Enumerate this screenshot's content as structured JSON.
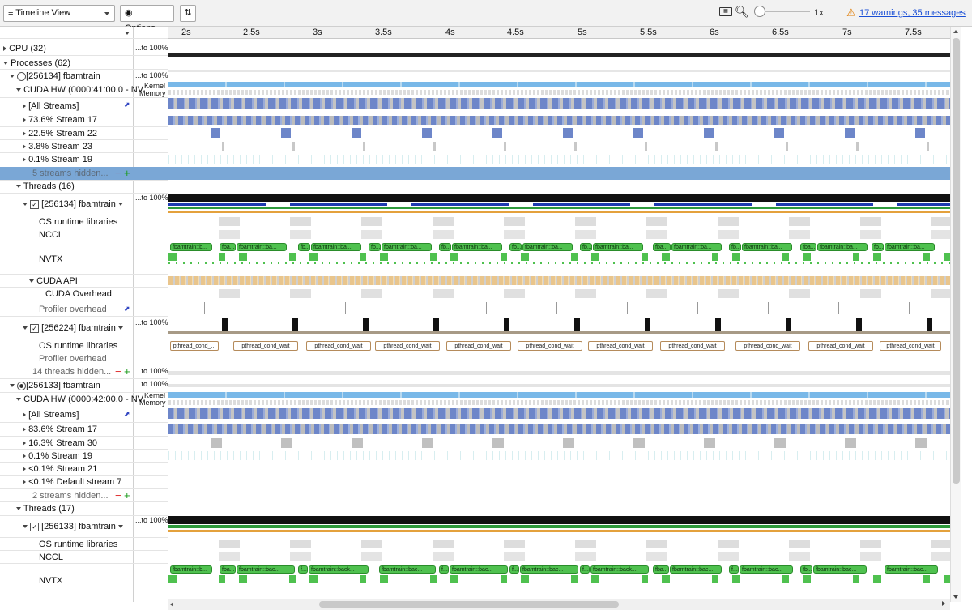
{
  "toolbar": {
    "view_label": "Timeline View",
    "options_label": "Options...",
    "zoom_label": "1x",
    "warnings_label": "17 warnings, 35 messages"
  },
  "ruler": {
    "ticks": [
      "2s",
      "2.5s",
      "3s",
      "3.5s",
      "4s",
      "4.5s",
      "5s",
      "5.5s",
      "6s",
      "6.5s",
      "7s",
      "7.5s"
    ]
  },
  "rows": {
    "cpu": "CPU (32)",
    "processes": "Processes (62)",
    "proc1": "[256134] fbamtrain",
    "cuda_hw1": "CUDA HW (0000:41:00.0 - NV",
    "all_streams1": "[All Streams]",
    "s17a": "73.6% Stream 17",
    "s22": "22.5% Stream 22",
    "s23": "3.8% Stream 23",
    "s19a": "0.1% Stream 19",
    "hidden_streams1": "5 streams hidden...",
    "threads16": "Threads (16)",
    "thread1": "[256134] fbamtrain",
    "osrt1": "OS runtime libraries",
    "nccl1": "NCCL",
    "nvtx1": "NVTX",
    "cuda_api": "CUDA API",
    "cuda_overhead": "CUDA Overhead",
    "profiler_overhead1": "Profiler overhead",
    "thread2": "[256224] fbamtrain",
    "osrt2": "OS runtime libraries",
    "profiler_overhead2": "Profiler overhead",
    "hidden_threads": "14 threads hidden...",
    "proc2": "[256133] fbamtrain",
    "cuda_hw2": "CUDA HW (0000:42:00.0 - NV",
    "all_streams2": "[All Streams]",
    "s17b": "83.6% Stream 17",
    "s30": "16.3% Stream 30",
    "s19b": "0.1% Stream 19",
    "s21": "<0.1% Stream 21",
    "default7": "<0.1% Default stream 7",
    "hidden_streams2": "2 streams hidden...",
    "threads17": "Threads (17)",
    "thread3": "[256133] fbamtrain",
    "osrt3": "OS runtime libraries",
    "nccl3": "NCCL",
    "nvtx3": "NVTX"
  },
  "scale": {
    "to100": "...to 100%",
    "kernel": "Kernel",
    "memory": "Memory"
  },
  "nvtx_labels": {
    "fb_ba": "fbamtrain::ba...",
    "fb_b": "fbamtrain::b...",
    "fba": "fba...",
    "fb": "fb...",
    "fb_back": "fbamtrain::back...",
    "fb_bac": "fbamtrain::bac...",
    "f": "f..."
  },
  "pthread": {
    "short": "pthread_cond_...",
    "full": "pthread_cond_wait"
  },
  "colors": {
    "kernel_blue": "#6d86c9",
    "memory_blue": "#79b8e8",
    "nvtx_green": "#4fc14f",
    "cuda_api_tan": "#e9c58c",
    "selected_row": "#7aa7d6",
    "warning": "#e07b00",
    "link": "#1a4fd6"
  }
}
